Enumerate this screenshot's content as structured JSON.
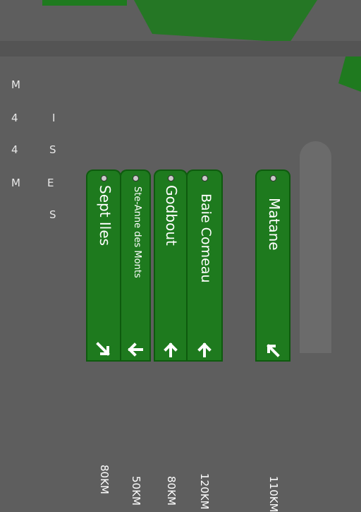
{
  "signs": [
    {
      "name": "Sept Iles",
      "distance": "80KM",
      "arrow": "arrow-down-right-icon"
    },
    {
      "name": "Ste-Anne des Monts",
      "distance": "50KM",
      "arrow": "arrow-left-icon"
    },
    {
      "name": "Godbout",
      "distance": "80KM",
      "arrow": "arrow-up-icon"
    },
    {
      "name": "Baie Comeau",
      "distance": "120KM",
      "arrow": "arrow-up-icon"
    },
    {
      "name": "Matane",
      "distance": "110KM",
      "arrow": "arrow-up-left-icon"
    }
  ],
  "glyph_rows": [
    {
      "a": "M",
      "b": "",
      "c": ""
    },
    {
      "a": "4",
      "b": "I",
      "c": ""
    },
    {
      "a": "4",
      "b": "S",
      "c": ""
    },
    {
      "a": "M",
      "b": "E",
      "c": ""
    },
    {
      "a": "",
      "b": "S",
      "c": ""
    }
  ],
  "colors": {
    "sign_green": "#1e7a1e",
    "background": "#5e5e5e",
    "texture_green": "#1f7a1f"
  }
}
